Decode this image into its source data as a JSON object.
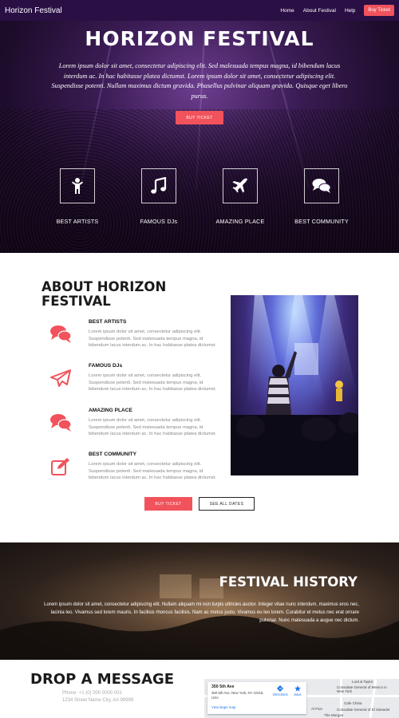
{
  "navbar": {
    "brand": "Horizon Festival",
    "links": [
      "Home",
      "About Festival",
      "Help"
    ],
    "cta": "Buy Ticket"
  },
  "hero": {
    "title": "HORIZON FESTIVAL",
    "subtitle": "Lorem ipsum dolor sit amet, consectetur adipiscing elit. Sed malesuada tempus magna, id bibendum lacus interdum ac. In hac habitasse platea dictumst. Lorem ipsum dolor sit amet, consectetur adipiscing elit. Suspendisse potenti. Nullam maximus dictum gravida. Phasellus pulvinar aliquam gravida. Quisque eget libero purus.",
    "button": "BUY TICKET",
    "features": [
      {
        "label": "BEST ARTISTS",
        "icon": "person-icon"
      },
      {
        "label": "FAMOUS DJs",
        "icon": "music-note-icon"
      },
      {
        "label": "AMAZING PLACE",
        "icon": "airplane-icon"
      },
      {
        "label": "BEST COMMUNITY",
        "icon": "chat-bubbles-icon"
      }
    ]
  },
  "about": {
    "title": "ABOUT HORIZON FESTIVAL",
    "items": [
      {
        "heading": "BEST ARTISTS",
        "text": "Lorem ipsum dolor sit amet, consectetur adipiscing elit. Suspendisse potenti. Sed malesuada tempus magna, id bibendum lacus interdum ac. In hac habitasse platea dictumst.",
        "icon": "chat-bubbles-icon"
      },
      {
        "heading": "FAMOUS DJs",
        "text": "Lorem ipsum dolor sit amet, consectetur adipiscing elit. Suspendisse potenti. Sed malesuada tempus magna, id bibendum lacus interdum ac. In hac habitasse platea dictumst.",
        "icon": "paper-plane-icon"
      },
      {
        "heading": "AMAZING PLACE",
        "text": "Lorem ipsum dolor sit amet, consectetur adipiscing elit. Suspendisse potenti. Sed malesuada tempus magna, id bibendum lacus interdum ac. In hac habitasse platea dictumst.",
        "icon": "chat-bubbles-icon"
      },
      {
        "heading": "BEST COMMUNITY",
        "text": "Lorem ipsum dolor sit amet, consectetur adipiscing elit. Suspendisse potenti. Sed malesuada tempus magna, id bibendum lacus interdum ac. In hac habitasse platea dictumst.",
        "icon": "edit-icon"
      }
    ],
    "buy_button": "BUY TICKET",
    "dates_button": "SEE ALL DATES"
  },
  "history": {
    "title": "FESTIVAL HISTORY",
    "text": "Lorem ipsum dolor sit amet, consectetur adipiscing elit. Nullam aliquam mi non turpis ultricies auctor. Integer vitae nunc interdum, maximus eros nec, lacinia leo. Vivamus sed lorem mauris. In facilisis rhoncus facilisis. Nam ac metus justo. Vivamus eu leo lorem. Curabitur et metus nec erat ornare pulvinar. Nunc malesuada a augue nec dictum."
  },
  "message": {
    "title": "DROP A MESSAGE",
    "phone": "Phone: +1 (0) 000 0000 001",
    "address": "1234 Street Name City, AA 99999",
    "map": {
      "place": "350 5th Ave",
      "address": "350 5th Ave, New York, NY 10118, USA",
      "link": "View larger map",
      "directions": "Directions",
      "save": "Save",
      "labels": [
        "Lord & Taylor",
        "Consulate General of Mexico in New York",
        "Cafe China",
        "Al Fion",
        "Consulate General of El Salvador",
        "The Morgan"
      ]
    }
  },
  "colors": {
    "accent": "#f1525b",
    "nav_bg": "#2a0f45"
  }
}
